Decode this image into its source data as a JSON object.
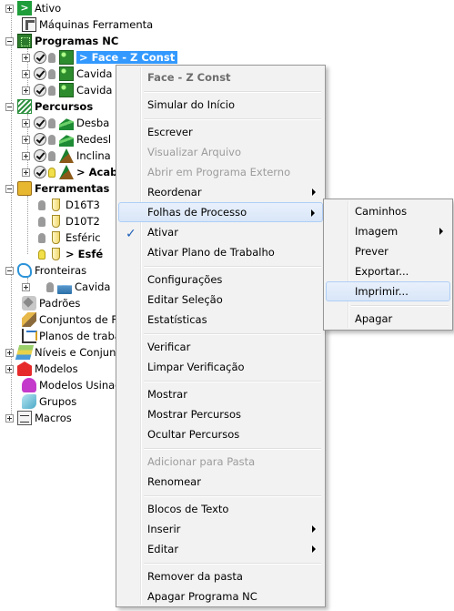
{
  "tree": {
    "items": [
      {
        "label": "Ativo"
      },
      {
        "label": "Máquinas Ferramenta"
      },
      {
        "label": "Programas NC"
      },
      {
        "label": "> Face - Z Const"
      },
      {
        "label": "Cavida"
      },
      {
        "label": "Cavida"
      },
      {
        "label": "Percursos"
      },
      {
        "label": "Desba"
      },
      {
        "label": "Redesl"
      },
      {
        "label": "Inclina"
      },
      {
        "label": "> Acab"
      },
      {
        "label": "Ferramentas"
      },
      {
        "label": "D16T3"
      },
      {
        "label": "D10T2"
      },
      {
        "label": "Esféric"
      },
      {
        "label": "> Esfé"
      },
      {
        "label": "Fronteiras"
      },
      {
        "label": "Cavida"
      },
      {
        "label": "Padrões"
      },
      {
        "label": "Conjuntos de Fi"
      },
      {
        "label": "Planos de trabal"
      },
      {
        "label": "Níveis e Conjunt"
      },
      {
        "label": "Modelos"
      },
      {
        "label": "Modelos Usinad"
      },
      {
        "label": "Grupos"
      },
      {
        "label": "Macros"
      }
    ]
  },
  "context_menu": {
    "header": "Face - Z Const",
    "items": [
      "Simular do Início",
      "Escrever",
      "Visualizar Arquivo",
      "Abrir em Programa Externo",
      "Reordenar",
      "Folhas de Processo",
      "Ativar",
      "Ativar Plano de Trabalho",
      "Configurações",
      "Editar Seleção",
      "Estatísticas",
      "Verificar",
      "Limpar Verificação",
      "Mostrar",
      "Mostrar Percursos",
      "Ocultar Percursos",
      "Adicionar para Pasta",
      "Renomear",
      "Blocos de Texto",
      "Inserir",
      "Editar",
      "Remover da pasta",
      "Apagar Programa NC"
    ],
    "check_glyph": "✓"
  },
  "submenu": {
    "items": [
      "Caminhos",
      "Imagem",
      "Prever",
      "Exportar...",
      "Imprimir...",
      "Apagar"
    ]
  },
  "colors": {
    "selection": "#3399ff",
    "menu_highlight": "#d9e6f8"
  }
}
